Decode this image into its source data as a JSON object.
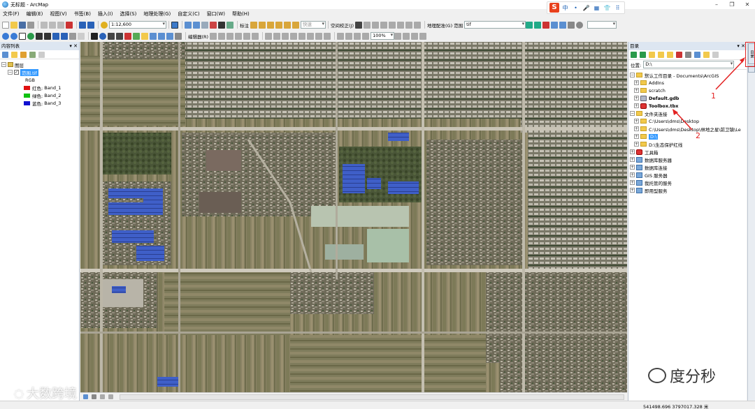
{
  "window": {
    "title": "无标题 - ArcMap",
    "controls": [
      "–",
      "❐",
      "✕"
    ]
  },
  "menu": [
    "文件(F)",
    "编辑(E)",
    "视图(V)",
    "书签(B)",
    "插入(I)",
    "选择(S)",
    "地理处理(G)",
    "自定义(C)",
    "窗口(W)",
    "帮助(H)"
  ],
  "ime": {
    "logo": "S",
    "mode": "中",
    "icons": [
      "•",
      "🎤",
      "▦",
      "👕",
      "⠿"
    ]
  },
  "toolbar1": {
    "scale": "1:12,600",
    "editor_label": "标注",
    "snap_label": "快速",
    "georef_label": "空间校正(J)",
    "geoproc_label": "地理配准(G)",
    "range_label": "范围",
    "range_value": "tif",
    "search_value": ""
  },
  "toolbar2": {
    "editor_label": "编辑器(R)",
    "zoom_value": "100%"
  },
  "toc": {
    "title": "内容列表",
    "items": [
      {
        "label": "图层"
      },
      {
        "label": "范围.tif"
      },
      {
        "label": "RGB"
      },
      {
        "label": "红色:",
        "band": "Band_1",
        "color": "#e01010"
      },
      {
        "label": "绿色:",
        "band": "Band_2",
        "color": "#10c010"
      },
      {
        "label": "蓝色:",
        "band": "Band_3",
        "color": "#1010d0"
      }
    ]
  },
  "catalog": {
    "title": "目录",
    "location_label": "位置:",
    "location_value": "D:\\",
    "items": [
      {
        "label": "默认工作目录 - Documents\\ArcGIS"
      },
      {
        "label": "AddIns"
      },
      {
        "label": "scratch"
      },
      {
        "label": "Default.gdb"
      },
      {
        "label": "Toolbox.tbx"
      },
      {
        "label": "文件夹连接"
      },
      {
        "label": "C:\\Users\\dms\\Desktop"
      },
      {
        "label": "C:\\Users\\dms\\Desktop\\林地之星\\前卫镇\\Le"
      },
      {
        "label": "D:\\"
      },
      {
        "label": "D:\\生态保护红线"
      },
      {
        "label": "工具箱"
      },
      {
        "label": "数据库服务器"
      },
      {
        "label": "数据库连接"
      },
      {
        "label": "GIS 服务器"
      },
      {
        "label": "我托管的服务"
      },
      {
        "label": "即用型服务"
      }
    ]
  },
  "side_tab": "目录",
  "annotations": {
    "n1": "1",
    "n2": "2"
  },
  "status": {
    "coords": "541498.696  3797017.328 米"
  },
  "watermarks": {
    "left": "大数跨境",
    "right": "度分秒"
  },
  "colors": {
    "accent": "#3399ff",
    "annotation": "#e32222",
    "panel_title": "#dde6f1"
  }
}
